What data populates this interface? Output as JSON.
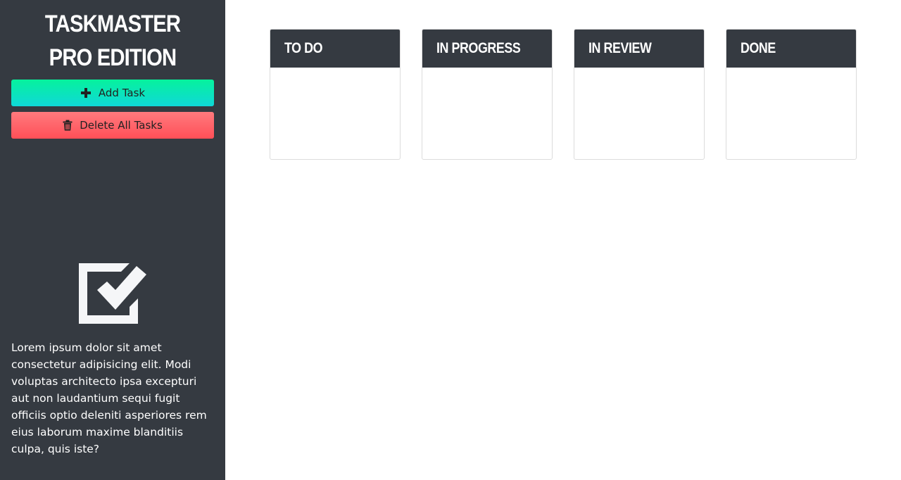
{
  "app": {
    "title": "TASKMASTER PRO EDITION"
  },
  "sidebar": {
    "add_button_label": "Add Task",
    "add_button_icon": "plus-icon",
    "delete_button_label": "Delete All Tasks",
    "delete_button_icon": "trash-icon",
    "logo_icon": "checkbox-checked-icon",
    "description": "Lorem ipsum dolor sit amet consectetur adipisicing elit. Modi voluptas architecto ipsa excepturi aut non laudantium sequi fugit officiis optio deleniti asperiores rem eius laborum maxime blanditiis culpa, quis iste?"
  },
  "board": {
    "columns": [
      {
        "title": "TO DO"
      },
      {
        "title": "IN PROGRESS"
      },
      {
        "title": "IN REVIEW"
      },
      {
        "title": "DONE"
      }
    ]
  },
  "colors": {
    "sidebar_bg": "#353a41",
    "add_button_gradient": [
      "#06f29c",
      "#0fd8d8"
    ],
    "delete_button_gradient": [
      "#ff7a7e",
      "#ff4f57"
    ],
    "column_header_bg": "#353a41"
  }
}
